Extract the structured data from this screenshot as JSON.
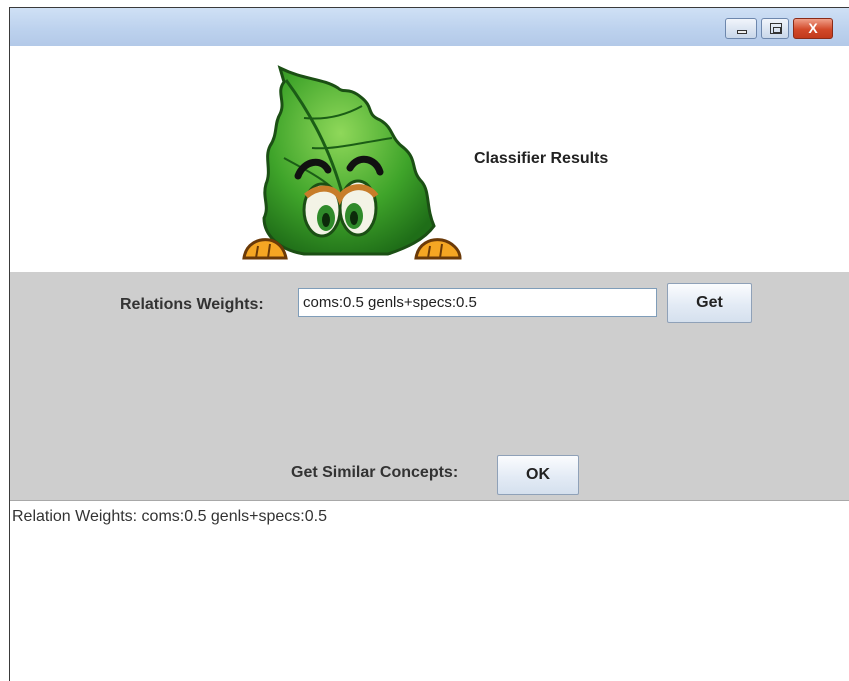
{
  "window": {
    "title": "",
    "controls": {
      "minimize_icon": "minimize-icon",
      "maximize_icon": "maximize-icon",
      "close_icon": "close-icon",
      "close_glyph": "X"
    }
  },
  "header": {
    "mascot_icon": "leaf-mascot-icon",
    "title": "Classifier Results"
  },
  "controls": {
    "weights_label": "Relations Weights:",
    "weights_value": "coms:0.5 genls+specs:0.5",
    "get_button": "Get",
    "similar_label": "Get Similar Concepts:",
    "ok_button": "OK"
  },
  "output": {
    "text": "Relation Weights: coms:0.5 genls+specs:0.5"
  },
  "colors": {
    "titlebar": "#bdd2ee",
    "panel_bg": "#cecece",
    "leaf_green": "#3fa42a",
    "close_red": "#d2492a"
  }
}
